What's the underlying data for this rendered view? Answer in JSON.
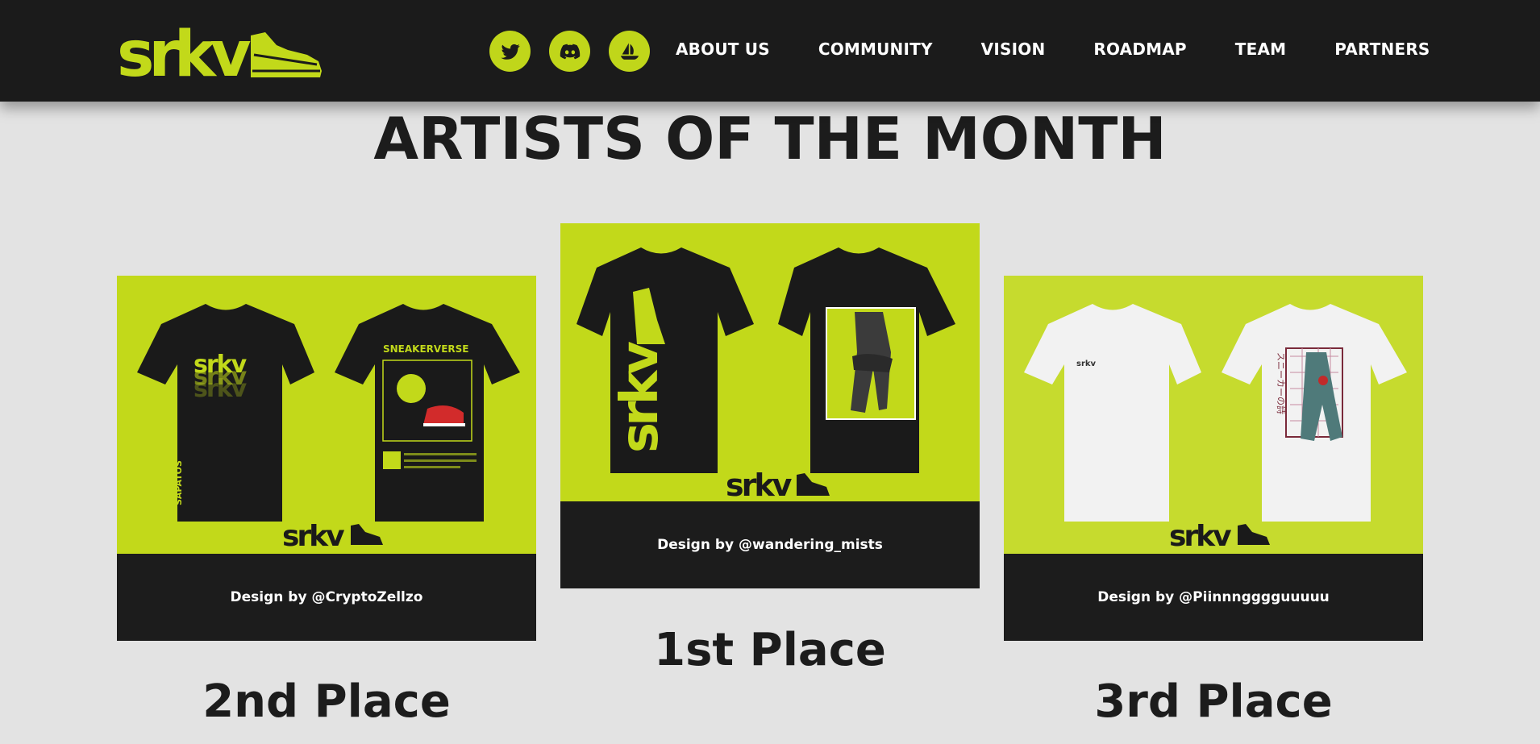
{
  "header": {
    "logo_text": "srkv",
    "socials": [
      {
        "name": "twitter-icon"
      },
      {
        "name": "discord-icon"
      },
      {
        "name": "opensea-icon"
      }
    ],
    "nav": [
      "ABOUT US",
      "COMMUNITY",
      "VISION",
      "ROADMAP",
      "TEAM",
      "PARTNERS"
    ]
  },
  "main": {
    "title": "ARTISTS OF THE MONTH",
    "cards": [
      {
        "place": "2nd Place",
        "caption": "Design by @CryptoZellzo",
        "shirt_color": "black",
        "front_text": "srkv",
        "side_text": "SAPATOS",
        "back_text": "SNEAKERVERSE"
      },
      {
        "place": "1st Place",
        "caption": "Design by @wandering_mists",
        "shirt_color": "black",
        "front_text": "srkv"
      },
      {
        "place": "3rd Place",
        "caption": "Design by @Piinnngggguuuuu",
        "shirt_color": "white",
        "back_text": "スニーカーの詩"
      }
    ]
  },
  "colors": {
    "accent": "#c2d91a",
    "dark": "#1b1b1b",
    "background": "#e3e3e3"
  }
}
